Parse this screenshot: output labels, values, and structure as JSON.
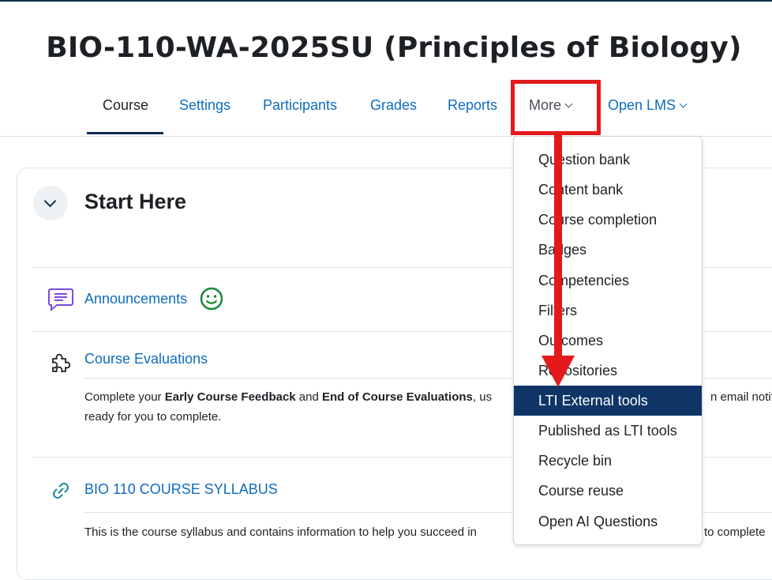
{
  "course": {
    "title": "BIO-110-WA-2025SU (Principles of Biology)"
  },
  "nav": {
    "tabs": [
      {
        "label": "Course",
        "active": true
      },
      {
        "label": "Settings"
      },
      {
        "label": "Participants"
      },
      {
        "label": "Grades"
      },
      {
        "label": "Reports"
      },
      {
        "label": "More"
      },
      {
        "label": "Open LMS"
      }
    ]
  },
  "section": {
    "title": "Start Here"
  },
  "activities": {
    "announcements": {
      "label": "Announcements"
    },
    "evaluations": {
      "label": "Course Evaluations",
      "desc_prefix": "Complete your ",
      "desc_bold1": "Early Course Feedback",
      "desc_mid": " and ",
      "desc_bold2": "End of Course Evaluations",
      "desc_suffix": ", us",
      "desc_right": "n email notif",
      "desc_line2": "ready for you to complete."
    },
    "syllabus": {
      "label": "BIO 110 COURSE SYLLABUS",
      "desc": "This is the course syllabus and contains information to help you succeed in",
      "desc_right": "to complete"
    }
  },
  "more_menu": {
    "items": [
      "Question bank",
      "Content bank",
      "Course completion",
      "Badges",
      "Competencies",
      "Filters",
      "Outcomes",
      "Repositories",
      "LTI External tools",
      "Published as LTI tools",
      "Recycle bin",
      "Course reuse",
      "Open AI Questions"
    ],
    "active_index": 8
  },
  "colors": {
    "link": "#0f6cbf",
    "nav_active": "#0f2d52",
    "highlight": "#e3191b",
    "menu_active_bg": "#0f3567"
  }
}
